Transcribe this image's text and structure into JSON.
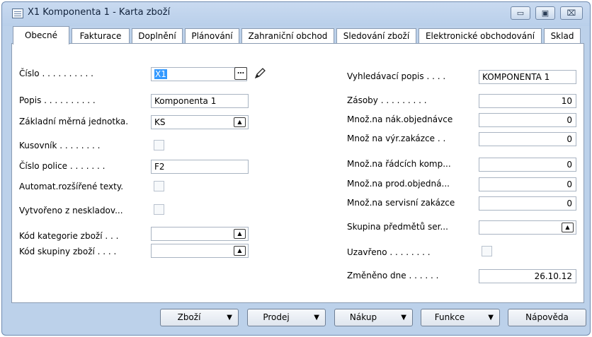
{
  "window": {
    "title": "X1 Komponenta 1 - Karta zboží",
    "controls": {
      "minimize": "▭",
      "maximize": "▣",
      "close": "⌧"
    }
  },
  "tabs": [
    {
      "label": "Obecné",
      "active": true
    },
    {
      "label": "Fakturace"
    },
    {
      "label": "Doplnění"
    },
    {
      "label": "Plánování"
    },
    {
      "label": "Zahraniční obchod"
    },
    {
      "label": "Sledování zboží"
    },
    {
      "label": "Elektronické obchodování"
    },
    {
      "label": "Sklad"
    }
  ],
  "left_fields": {
    "cislo": {
      "label": "Číslo . . . . . . . . . .",
      "value": "X1"
    },
    "popis": {
      "label": "Popis . . . . . . . . . .",
      "value": "Komponenta 1"
    },
    "mj": {
      "label": "Základní měrná jednotka.",
      "value": "KS"
    },
    "kusovnik": {
      "label": "Kusovník . . . . . . . ."
    },
    "police": {
      "label": "Číslo police . . . . . . .",
      "value": "F2"
    },
    "auto_texty": {
      "label": "Automat.rozšířené texty."
    },
    "vytvoreno": {
      "label": "Vytvořeno z neskladov..."
    },
    "kategorie": {
      "label": "Kód kategorie zboží . . .",
      "value": ""
    },
    "skupina": {
      "label": "Kód skupiny zboží . . . .",
      "value": ""
    }
  },
  "right_fields": {
    "vyhledavaci": {
      "label": "Vyhledávací popis . . . .",
      "value": "KOMPONENTA 1"
    },
    "zasoby": {
      "label": "Zásoby . . . . . . . . .",
      "value": "10"
    },
    "nak_obj": {
      "label": "Množ.na nák.objednávce",
      "value": "0"
    },
    "vyr_zak": {
      "label": "Množ na výr.zakázce . .",
      "value": "0"
    },
    "radky_komp": {
      "label": "Množ.na řádcích komp...",
      "value": "0"
    },
    "prod_obj": {
      "label": "Množ.na prod.objedná...",
      "value": "0"
    },
    "serv_zak": {
      "label": "Množ.na servisní zakázce",
      "value": "0"
    },
    "skupina_predmetu": {
      "label": "Skupina předmětů ser...",
      "value": ""
    },
    "uzavreno": {
      "label": "Uzavřeno . . . . . . . ."
    },
    "zmeneno": {
      "label": "Změněno dne . . . . . .",
      "value": "26.10.12"
    }
  },
  "buttons": {
    "zbozi": {
      "label": "Zboží"
    },
    "prodej": {
      "label": "Prodej"
    },
    "nakup": {
      "label": "Nákup"
    },
    "funkce": {
      "label": "Funkce"
    },
    "napoveda": {
      "label": "Nápověda"
    }
  },
  "icons": {
    "dropdown": "▲",
    "menu_arrow": "▼",
    "lookup": "…"
  }
}
